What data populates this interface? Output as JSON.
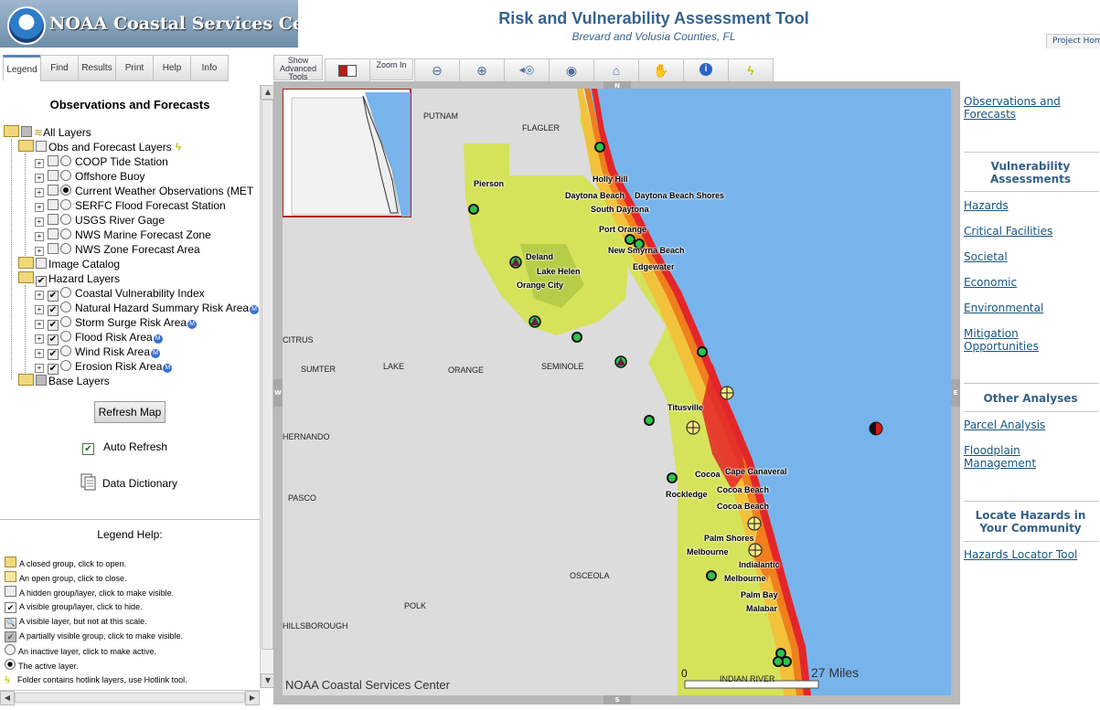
{
  "header": {
    "org_name": "NOAA Coastal Services Center",
    "title": "Risk and Vulnerability Assessment Tool",
    "subtitle": "Brevard and Volusia Counties, FL",
    "project_home": "Project Home"
  },
  "tabs": [
    "Legend",
    "Find",
    "Results",
    "Print",
    "Help",
    "Info"
  ],
  "panel": {
    "title": "Observations and Forecasts",
    "refresh_button": "Refresh Map",
    "auto_refresh": "Auto Refresh",
    "auto_refresh_checked": true,
    "data_dictionary": "Data Dictionary"
  },
  "layers": {
    "all_layers": "All Layers",
    "obs_group": "Obs and Forecast Layers",
    "obs_items": [
      "COOP Tide Station",
      "Offshore Buoy",
      "Current Weather Observations (MET",
      "SERFC Flood Forecast Station",
      "USGS River Gage",
      "NWS Marine Forecast Zone",
      "NWS Zone Forecast Area"
    ],
    "image_catalog": "Image Catalog",
    "hazard_group": "Hazard Layers",
    "hazard_items": [
      "Coastal Vulnerability Index",
      "Natural Hazard Summary Risk Area",
      "Storm Surge Risk Area",
      "Flood Risk Area",
      "Wind Risk Area",
      "Erosion Risk Area"
    ],
    "base_layers": "Base Layers"
  },
  "legend_help": {
    "title": "Legend Help:",
    "items": [
      "A closed group, click to open.",
      "An open group, click to close.",
      "A hidden group/layer, click to make visible.",
      "A visible group/layer, click to hide.",
      "A visible layer, but not at this scale.",
      "A partially visible group, click to make visible.",
      "An inactive layer, click to make active.",
      "The active layer.",
      "Folder contains hotlink layers, use Hotlink tool."
    ]
  },
  "toolbar": {
    "show_advanced": "Show Advanced Tools",
    "zoom_in": "Zoom In",
    "tool_icons": [
      "overview-map-icon",
      "zoom-out-icon",
      "zoom-in-icon",
      "zoom-previous-icon",
      "zoom-full-extent-icon",
      "pan-back-icon",
      "pan-hand-icon",
      "identify-info-icon",
      "hotlink-lightning-icon"
    ]
  },
  "map": {
    "compass": {
      "north": "N",
      "south": "S",
      "east": "E",
      "west": "W"
    },
    "copyright": "NOAA Coastal Services Center",
    "scale_start": "0",
    "scale_end": "27 Miles",
    "county_labels": [
      "PUTNAM",
      "FLAGLER",
      "CITRUS",
      "SUMTER",
      "LAKE",
      "ORANGE",
      "SEMINOLE",
      "HERNANDO",
      "PASCO",
      "OSCEOLA",
      "POLK",
      "HILLSBOROUGH",
      "INDIAN RIVER"
    ],
    "cities": [
      "Holly Hill",
      "Daytona Beach",
      "Daytona Beach Shores",
      "South Daytona",
      "Port Orange",
      "New Smyrna Beach",
      "Edgewater",
      "Pierson",
      "Deland",
      "Lake Helen",
      "Orange City",
      "Titusville",
      "Cocoa",
      "Cape Canaveral",
      "Rockledge",
      "Cocoa Beach",
      "Cocoa Beach",
      "Palm Shores",
      "Melbourne",
      "Indialantic",
      "Melbourne",
      "Palm Bay",
      "Malabar"
    ],
    "colors": {
      "water": "#78b4ec",
      "land": "#dcdcdc",
      "low_risk": "#d6e25a",
      "medium_risk": "#f2c23b",
      "high_risk": "#f07f1e",
      "very_high_risk": "#e4262a",
      "station_green": "#2fc24a"
    }
  },
  "right_panel": {
    "obs_link": "Observations and Forecasts",
    "vulnerability_heading": "Vulnerability Assessments",
    "vulnerability_links": [
      "Hazards",
      "Critical Facilities",
      "Societal",
      "Economic",
      "Environmental",
      "Mitigation Opportunities"
    ],
    "other_heading": "Other Analyses",
    "other_links": [
      "Parcel Analysis",
      "Floodplain Management"
    ],
    "locate_heading": "Locate Hazards in Your Community",
    "locate_links": [
      "Hazards Locator Tool"
    ]
  }
}
